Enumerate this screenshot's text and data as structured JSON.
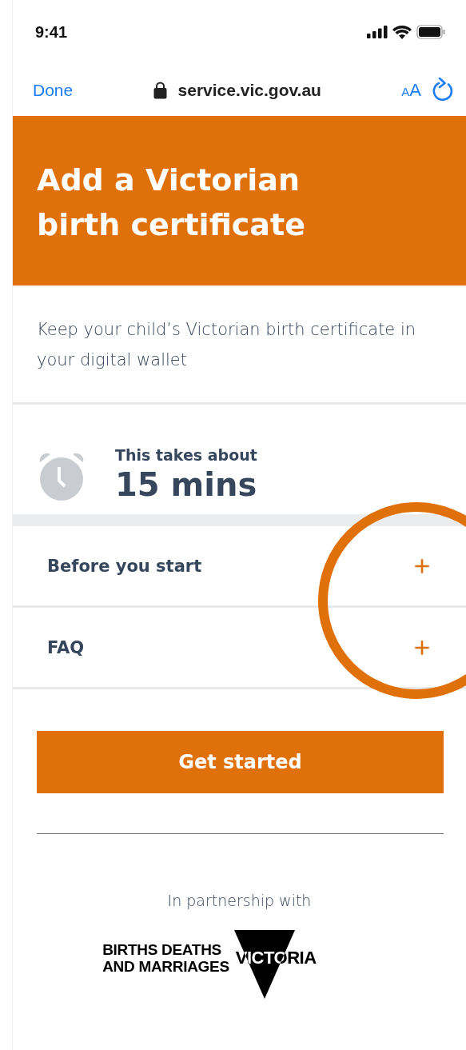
{
  "status_bar": {
    "time": "9:41"
  },
  "browser_bar": {
    "done": "Done",
    "url": "service.vic.gov.au",
    "text_size": "AA"
  },
  "header": {
    "title": "Add a Victorian birth certificate"
  },
  "intro": "Keep your child’s Victorian birth certificate in your digital wallet",
  "duration": {
    "label": "This takes about",
    "value": "15 mins"
  },
  "accordion": [
    {
      "label": "Before you start",
      "expanded": false
    },
    {
      "label": "FAQ",
      "expanded": false
    }
  ],
  "button": "Get started",
  "footer": {
    "partner_label": "In partnership with",
    "logo": {
      "line_1": "BIRTHS DEATHS",
      "line_2": "AND MARRIAGES",
      "wordmark": "VICTORIA"
    }
  }
}
